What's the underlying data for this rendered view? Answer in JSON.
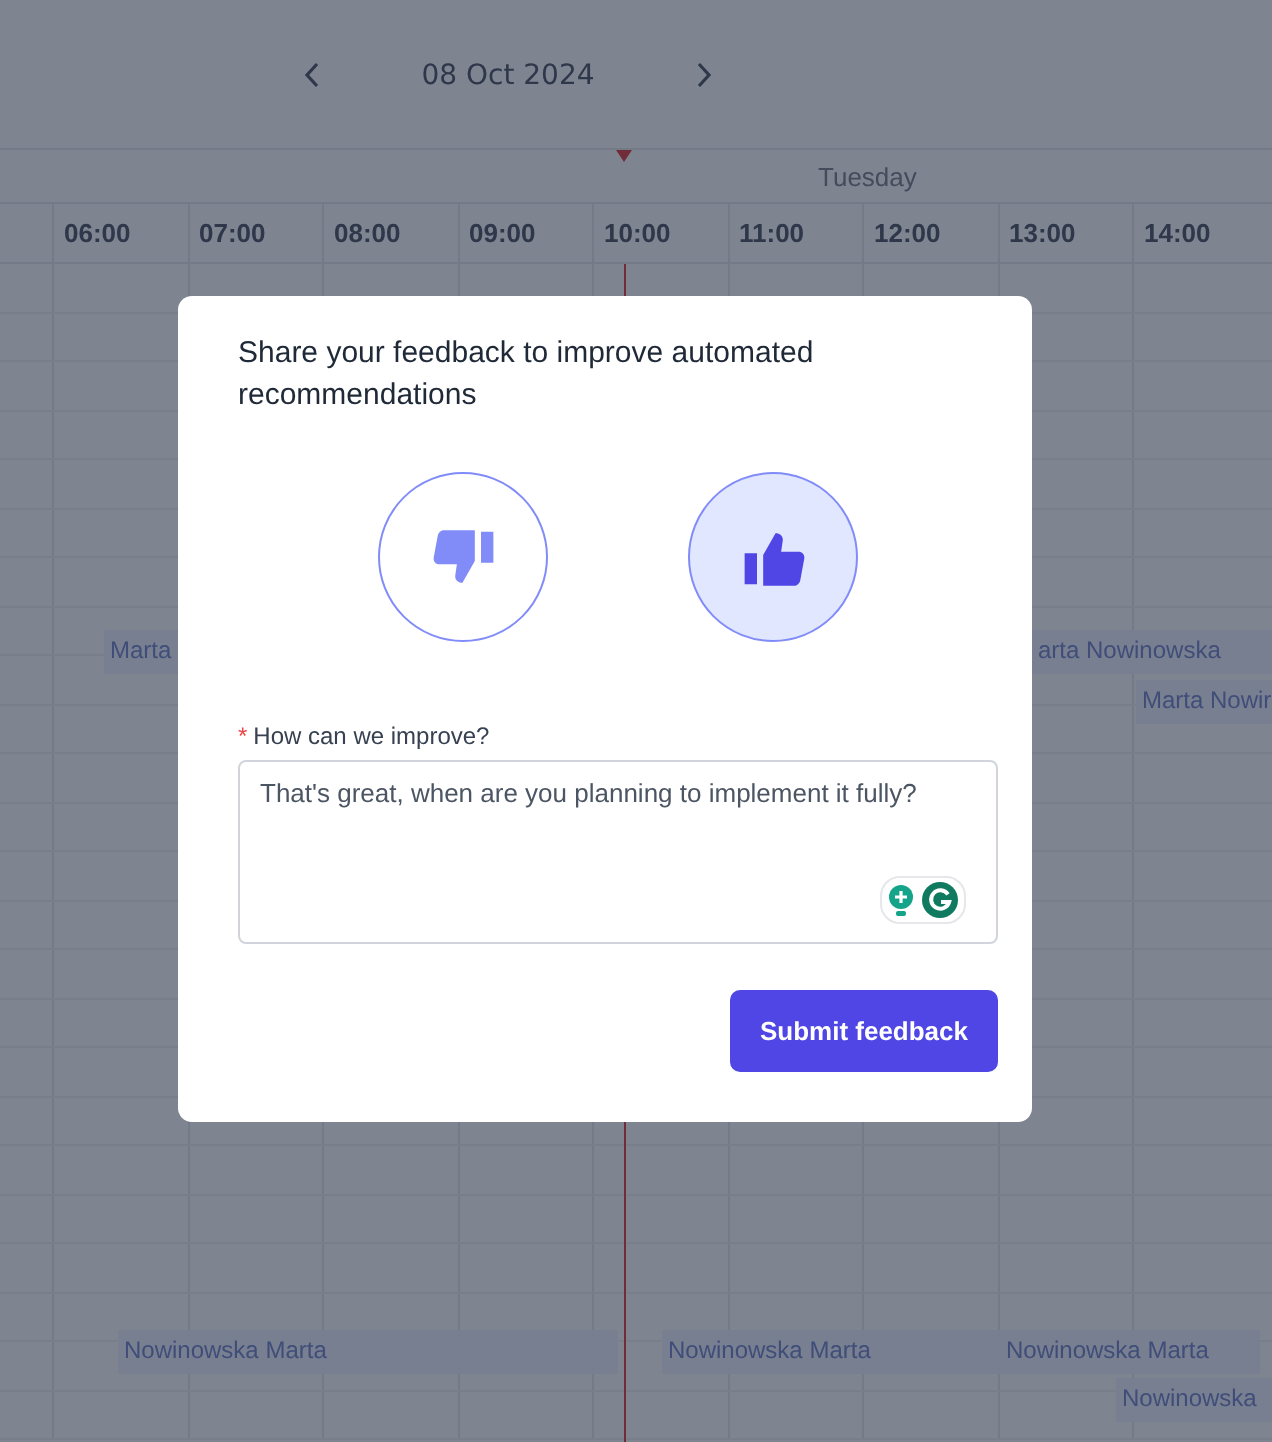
{
  "calendar": {
    "date": "08 Oct 2024",
    "day": "Tuesday",
    "hours": [
      "06:00",
      "07:00",
      "08:00",
      "09:00",
      "10:00",
      "11:00",
      "12:00",
      "13:00",
      "14:00"
    ],
    "events": [
      {
        "name": "Marta"
      },
      {
        "name": "arta Nowinowska"
      },
      {
        "name": "Marta Nowir"
      },
      {
        "name": "Nowinowska Marta"
      },
      {
        "name": "Nowinowska Marta"
      },
      {
        "name": "Nowinowska Marta"
      },
      {
        "name": "Nowinowska"
      }
    ]
  },
  "dialog": {
    "title": "Share your feedback to improve automated recommendations",
    "ratings": [
      {
        "kind": "thumbs_down",
        "selected": false
      },
      {
        "kind": "thumbs_up",
        "selected": true
      }
    ],
    "field": {
      "label": "How can we improve?",
      "required": true,
      "required_mark": "*",
      "value": "That's great, when are you planning to implement it fully?"
    },
    "submit": "Submit feedback"
  }
}
